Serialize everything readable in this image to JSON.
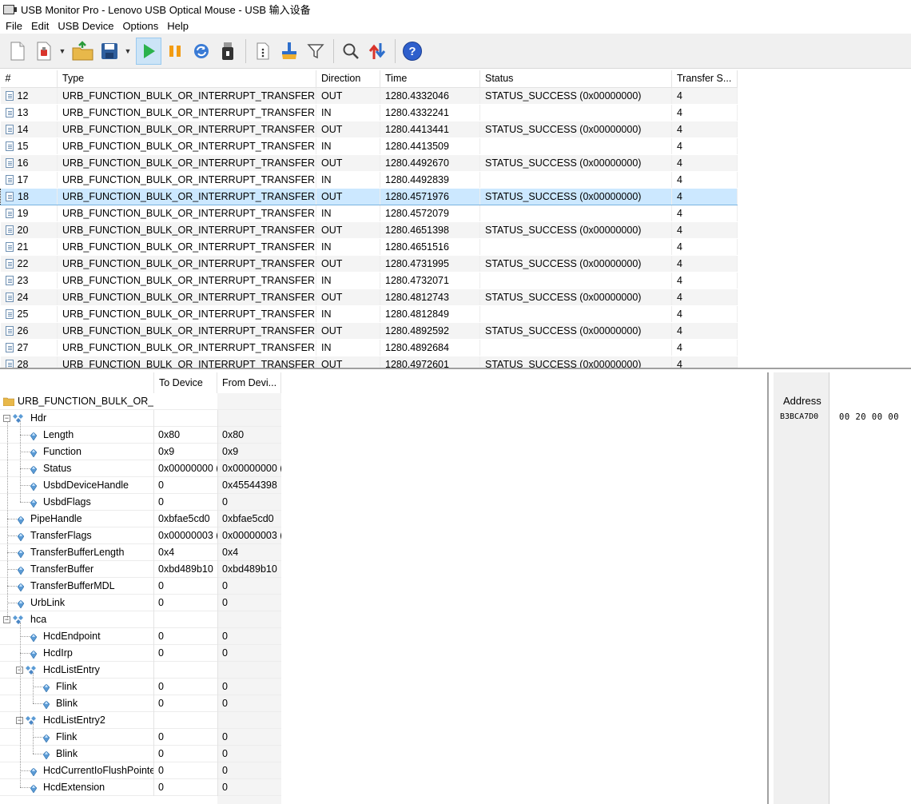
{
  "window": {
    "title": "USB Monitor Pro - Lenovo USB Optical Mouse - USB 输入设备"
  },
  "menu": [
    "File",
    "Edit",
    "USB Device",
    "Options",
    "Help"
  ],
  "toolbar": [
    {
      "name": "new-document-icon"
    },
    {
      "name": "open-capture-icon",
      "dropdown": true
    },
    {
      "name": "open-folder-icon"
    },
    {
      "name": "save-icon",
      "dropdown": true
    },
    {
      "name": "start-icon",
      "active": true
    },
    {
      "name": "pause-icon"
    },
    {
      "name": "refresh-icon"
    },
    {
      "name": "usb-device-icon"
    },
    {
      "name": "details-icon"
    },
    {
      "name": "clear-icon"
    },
    {
      "name": "filter-icon"
    },
    {
      "name": "search-icon"
    },
    {
      "name": "sort-icon"
    },
    {
      "name": "help-icon"
    }
  ],
  "grid": {
    "columns": [
      "#",
      "Type",
      "Direction",
      "Time",
      "Status",
      "Transfer S..."
    ],
    "rows": [
      {
        "num": "12",
        "type": "URB_FUNCTION_BULK_OR_INTERRUPT_TRANSFER",
        "dir": "OUT",
        "time": "1280.4332046",
        "status": "STATUS_SUCCESS (0x00000000)",
        "size": "4"
      },
      {
        "num": "13",
        "type": "URB_FUNCTION_BULK_OR_INTERRUPT_TRANSFER",
        "dir": "IN",
        "time": "1280.4332241",
        "status": "",
        "size": "4"
      },
      {
        "num": "14",
        "type": "URB_FUNCTION_BULK_OR_INTERRUPT_TRANSFER",
        "dir": "OUT",
        "time": "1280.4413441",
        "status": "STATUS_SUCCESS (0x00000000)",
        "size": "4"
      },
      {
        "num": "15",
        "type": "URB_FUNCTION_BULK_OR_INTERRUPT_TRANSFER",
        "dir": "IN",
        "time": "1280.4413509",
        "status": "",
        "size": "4"
      },
      {
        "num": "16",
        "type": "URB_FUNCTION_BULK_OR_INTERRUPT_TRANSFER",
        "dir": "OUT",
        "time": "1280.4492670",
        "status": "STATUS_SUCCESS (0x00000000)",
        "size": "4"
      },
      {
        "num": "17",
        "type": "URB_FUNCTION_BULK_OR_INTERRUPT_TRANSFER",
        "dir": "IN",
        "time": "1280.4492839",
        "status": "",
        "size": "4"
      },
      {
        "num": "18",
        "type": "URB_FUNCTION_BULK_OR_INTERRUPT_TRANSFER",
        "dir": "OUT",
        "time": "1280.4571976",
        "status": "STATUS_SUCCESS (0x00000000)",
        "size": "4",
        "selected": true
      },
      {
        "num": "19",
        "type": "URB_FUNCTION_BULK_OR_INTERRUPT_TRANSFER",
        "dir": "IN",
        "time": "1280.4572079",
        "status": "",
        "size": "4"
      },
      {
        "num": "20",
        "type": "URB_FUNCTION_BULK_OR_INTERRUPT_TRANSFER",
        "dir": "OUT",
        "time": "1280.4651398",
        "status": "STATUS_SUCCESS (0x00000000)",
        "size": "4"
      },
      {
        "num": "21",
        "type": "URB_FUNCTION_BULK_OR_INTERRUPT_TRANSFER",
        "dir": "IN",
        "time": "1280.4651516",
        "status": "",
        "size": "4"
      },
      {
        "num": "22",
        "type": "URB_FUNCTION_BULK_OR_INTERRUPT_TRANSFER",
        "dir": "OUT",
        "time": "1280.4731995",
        "status": "STATUS_SUCCESS (0x00000000)",
        "size": "4"
      },
      {
        "num": "23",
        "type": "URB_FUNCTION_BULK_OR_INTERRUPT_TRANSFER",
        "dir": "IN",
        "time": "1280.4732071",
        "status": "",
        "size": "4"
      },
      {
        "num": "24",
        "type": "URB_FUNCTION_BULK_OR_INTERRUPT_TRANSFER",
        "dir": "OUT",
        "time": "1280.4812743",
        "status": "STATUS_SUCCESS (0x00000000)",
        "size": "4"
      },
      {
        "num": "25",
        "type": "URB_FUNCTION_BULK_OR_INTERRUPT_TRANSFER",
        "dir": "IN",
        "time": "1280.4812849",
        "status": "",
        "size": "4"
      },
      {
        "num": "26",
        "type": "URB_FUNCTION_BULK_OR_INTERRUPT_TRANSFER",
        "dir": "OUT",
        "time": "1280.4892592",
        "status": "STATUS_SUCCESS (0x00000000)",
        "size": "4"
      },
      {
        "num": "27",
        "type": "URB_FUNCTION_BULK_OR_INTERRUPT_TRANSFER",
        "dir": "IN",
        "time": "1280.4892684",
        "status": "",
        "size": "4"
      },
      {
        "num": "28",
        "type": "URB_FUNCTION_BULK_OR_INTERRUPT_TRANSFER",
        "dir": "OUT",
        "time": "1280.4972601",
        "status": "STATUS_SUCCESS (0x00000000)",
        "size": "4"
      }
    ]
  },
  "tree": {
    "columns": [
      "To Device",
      "From Devi..."
    ],
    "root": "URB_FUNCTION_BULK_OR_IN",
    "rows": [
      {
        "label": "Hdr",
        "level": 0,
        "kind": "struct",
        "v1": "",
        "v2": ""
      },
      {
        "label": "Length",
        "level": 1,
        "kind": "field",
        "v1": "0x80",
        "v2": "0x80"
      },
      {
        "label": "Function",
        "level": 1,
        "kind": "field",
        "v1": "0x9",
        "v2": "0x9"
      },
      {
        "label": "Status",
        "level": 1,
        "kind": "field",
        "v1": "0x00000000 (",
        "v2": "0x00000000 ("
      },
      {
        "label": "UsbdDeviceHandle",
        "level": 1,
        "kind": "field",
        "v1": "0",
        "v2": "0x45544398"
      },
      {
        "label": "UsbdFlags",
        "level": 1,
        "kind": "field",
        "v1": "0",
        "v2": "0"
      },
      {
        "label": "PipeHandle",
        "level": 0,
        "kind": "field",
        "v1": "0xbfae5cd0",
        "v2": "0xbfae5cd0"
      },
      {
        "label": "TransferFlags",
        "level": 0,
        "kind": "field",
        "v1": "0x00000003 (",
        "v2": "0x00000003 ("
      },
      {
        "label": "TransferBufferLength",
        "level": 0,
        "kind": "field",
        "v1": "0x4",
        "v2": "0x4"
      },
      {
        "label": "TransferBuffer",
        "level": 0,
        "kind": "field",
        "v1": "0xbd489b10",
        "v2": "0xbd489b10"
      },
      {
        "label": "TransferBufferMDL",
        "level": 0,
        "kind": "field",
        "v1": "0",
        "v2": "0"
      },
      {
        "label": "UrbLink",
        "level": 0,
        "kind": "field",
        "v1": "0",
        "v2": "0"
      },
      {
        "label": "hca",
        "level": 0,
        "kind": "struct",
        "v1": "",
        "v2": ""
      },
      {
        "label": "HcdEndpoint",
        "level": 1,
        "kind": "field",
        "v1": "0",
        "v2": "0"
      },
      {
        "label": "HcdIrp",
        "level": 1,
        "kind": "field",
        "v1": "0",
        "v2": "0"
      },
      {
        "label": "HcdListEntry",
        "level": 1,
        "kind": "struct",
        "v1": "",
        "v2": ""
      },
      {
        "label": "Flink",
        "level": 2,
        "kind": "field",
        "v1": "0",
        "v2": "0"
      },
      {
        "label": "Blink",
        "level": 2,
        "kind": "field",
        "v1": "0",
        "v2": "0"
      },
      {
        "label": "HcdListEntry2",
        "level": 1,
        "kind": "struct",
        "v1": "",
        "v2": ""
      },
      {
        "label": "Flink",
        "level": 2,
        "kind": "field",
        "v1": "0",
        "v2": "0"
      },
      {
        "label": "Blink",
        "level": 2,
        "kind": "field",
        "v1": "0",
        "v2": "0"
      },
      {
        "label": "HcdCurrentIoFlushPointer",
        "level": 1,
        "kind": "field",
        "v1": "0",
        "v2": "0"
      },
      {
        "label": "HcdExtension",
        "level": 1,
        "kind": "field",
        "v1": "0",
        "v2": "0"
      }
    ]
  },
  "hex": {
    "header": "Address",
    "address": "B3BCA7D0",
    "bytes": "00 20 00 00"
  },
  "colors": {
    "selection": "#cce8ff",
    "play": "#2bb24c",
    "pause": "#f39c12",
    "help": "#2e5fcc"
  }
}
